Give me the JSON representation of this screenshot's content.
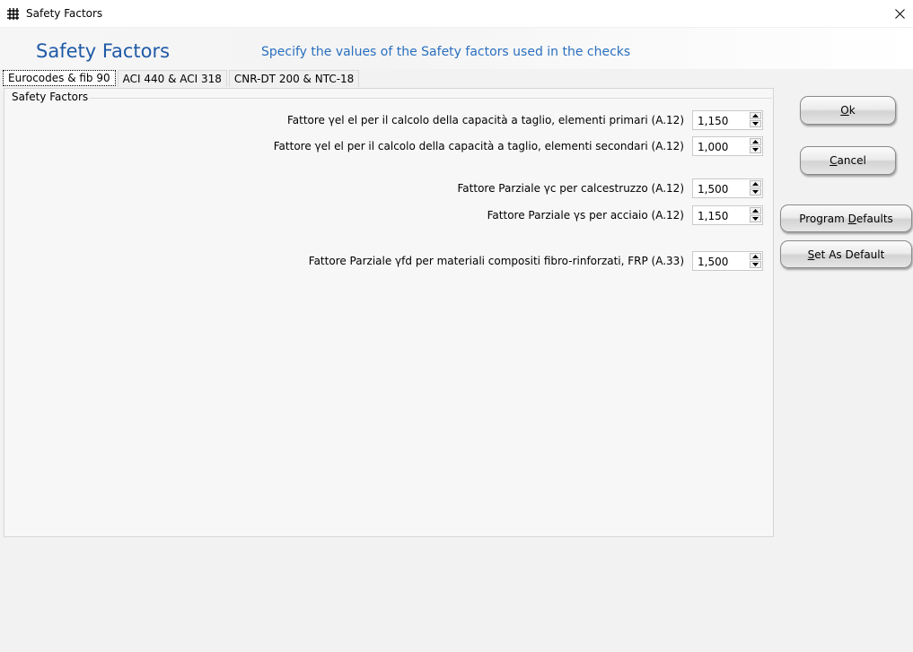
{
  "window": {
    "title": "Safety Factors",
    "app_icon": "grid-app-icon",
    "close_icon": "close-icon"
  },
  "header": {
    "title": "Safety Factors",
    "subtitle": "Specify the values of the Safety factors used in the checks",
    "title_color": "#1f5aa6",
    "subtitle_color": "#2a6fbf"
  },
  "tabs": [
    {
      "label": "Eurocodes & fib 90",
      "active": true
    },
    {
      "label": "ACI 440 & ACI 318",
      "active": false
    },
    {
      "label": "CNR-DT 200 & NTC-18",
      "active": false
    }
  ],
  "group": {
    "label": "Safety Factors"
  },
  "fields": [
    {
      "label": "Fattore γel el per il calcolo della capacità a taglio, elementi primari (A.12)",
      "value": "1,150"
    },
    {
      "label": "Fattore γel el per il calcolo della capacità a taglio, elementi secondari (A.12)",
      "value": "1,000"
    },
    {
      "label": "Fattore Parziale γc per calcestruzzo (A.12)",
      "value": "1,500"
    },
    {
      "label": "Fattore Parziale γs per acciaio (A.12)",
      "value": "1,150"
    },
    {
      "label": "Fattore Parziale γfd per materiali compositi fibro-rinforzati, FRP (A.33)",
      "value": "1,500"
    }
  ],
  "buttons": {
    "ok": {
      "mnemonic": "O",
      "rest": "k"
    },
    "cancel": {
      "mnemonic": "C",
      "rest": "ancel"
    },
    "program_defaults": {
      "before": "Program ",
      "mnemonic": "D",
      "rest": "efaults"
    },
    "set_as_default": {
      "mnemonic": "S",
      "rest": "et As Default"
    }
  }
}
